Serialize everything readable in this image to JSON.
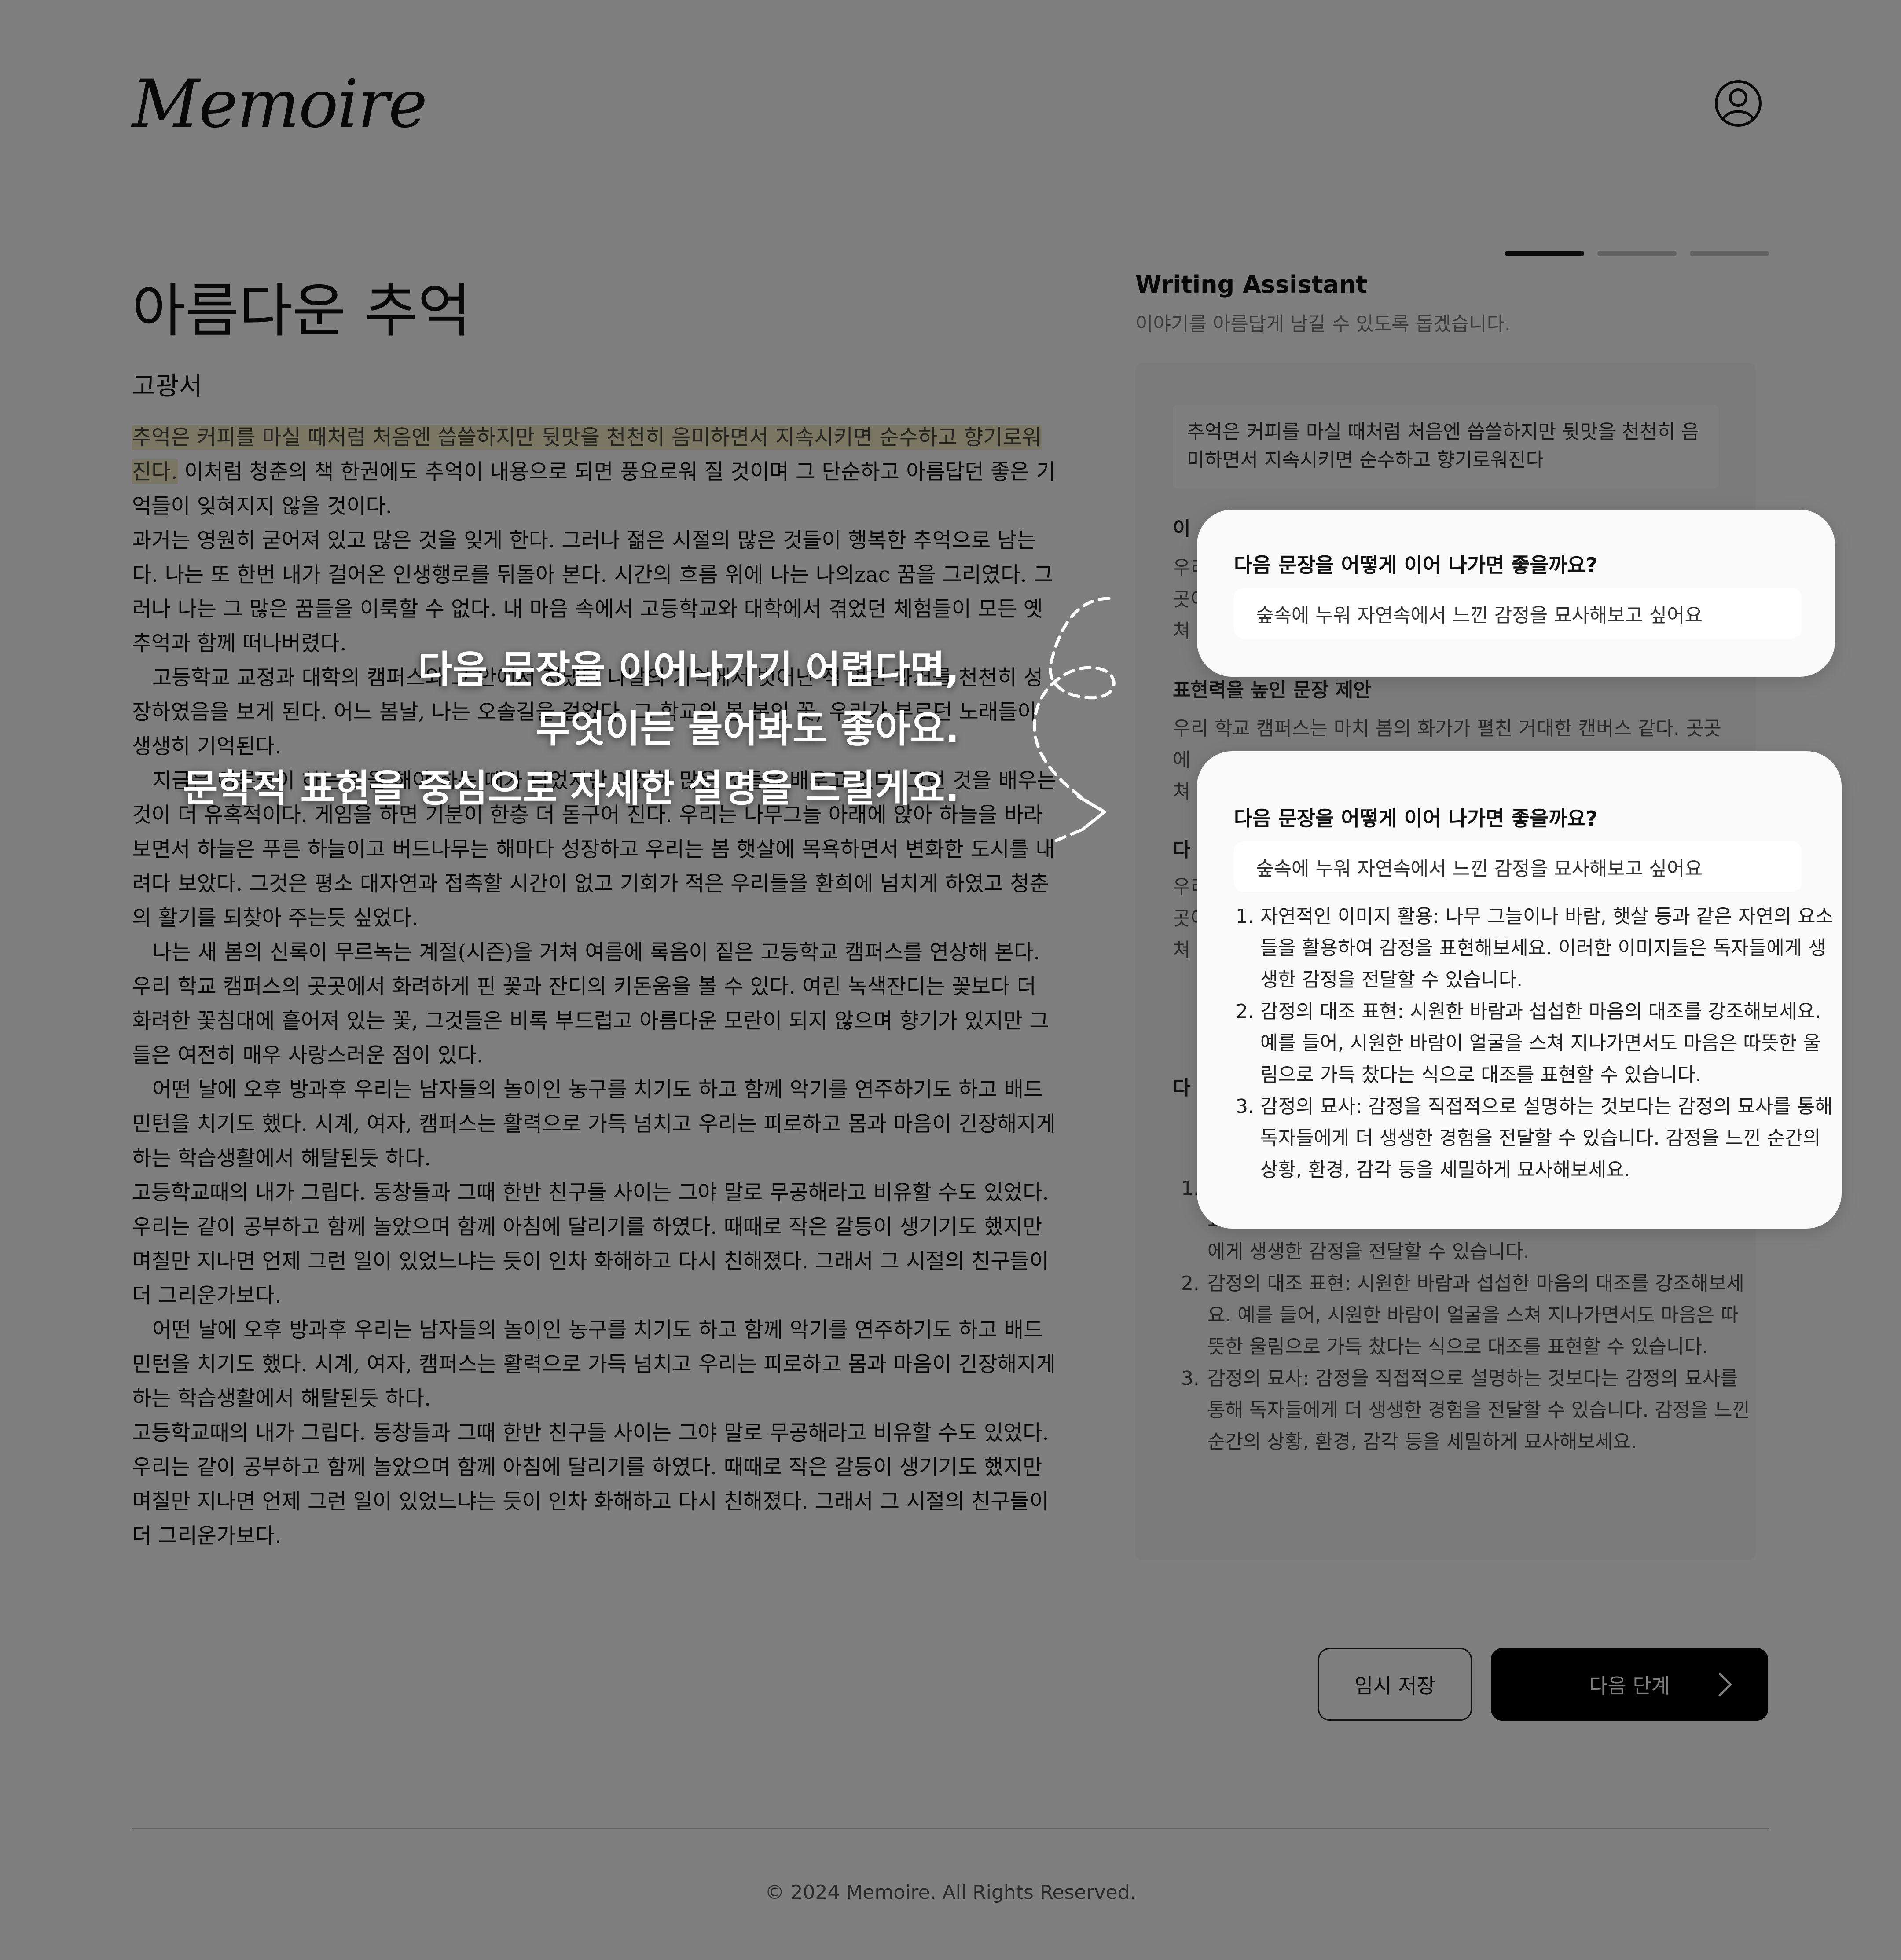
{
  "header": {
    "logo": "Memoire",
    "user_icon": "user-circle-icon"
  },
  "document": {
    "title": "아름다운 추억",
    "author": "고광서",
    "highlight": "추억은 커피를 마실 때처럼 처음엔 씁쓸하지만 뒷맛을 천천히 음미하면서 지속시키면 순수하고 향기로워진다.",
    "p1_rest": " 이처럼 청춘의 책 한권에도 추억이 내용으로 되면 풍요로워 질 것이며 그 단순하고 아름답던 좋은 기억들이 잊혀지지 않을 것이다.",
    "paragraphs": [
      "과거는 영원히 굳어져 있고 많은 것을 잊게 한다. 그러나 젊은 시절의 많은 것들이 행복한 추억으로 남는다. 나는 또 한번 내가 걸어온 인생행로를 뒤돌아 본다. 시간의 흐름 위에 나는 나의zac 꿈을 그리였다. 그러나 나는 그 많은 꿈들을 이룩할 수 없다. 내 마음 속에서 고등학교와 대학에서 겪었던 체험들이 모든 옛추억과 함께 떠나버렸다.",
      "고등학교 교정과 대학의 캠퍼스와 그 안에서 지냈던 나날의 기억에서 벗어난 적 없던 과거를 천천히 성장하였음을 보게 된다. 어느 봄날, 나는 오솔길을 걸었다. 그 학교의 봄 본인 꽃, 우리가 부르던 노래들이 생생히 기억된다.",
      "지금은 어른들이 하는 일을 해야 하는 때가 되었지만 여전히 많은 것들을 배우고 있다. 그런 것을 배우는 것이 더 유혹적이다. 게임을 하면 기분이 한층 더 돋구어 진다. 우리는 나무그늘 아래에 앉아 하늘을 바라보면서 하늘은 푸른 하늘이고 버드나무는 해마다 성장하고 우리는 봄 햇살에 목욕하면서 변화한 도시를 내려다 보았다. 그것은 평소 대자연과 접촉할 시간이 없고 기회가 적은 우리들을 환희에 넘치게 하였고 청춘의 활기를 되찾아 주는듯 싶었다.",
      "나는 새 봄의 신록이 무르녹는 계절(시즌)을 거쳐 여름에 록음이 짙은 고등학교 캠퍼스를 연상해 본다. 우리 학교 캠퍼스의 곳곳에서 화려하게 핀 꽃과 잔디의 키돈움을 볼 수 있다. 여린 녹색잔디는 꽃보다 더 화려한 꽃침대에 흩어져 있는 꽃, 그것들은 비록 부드럽고 아름다운 모란이 되지 않으며  향기가 있지만 그들은 여전히 매우 사랑스러운 점이 있다.",
      "어떤 날에 오후 방과후 우리는 남자들의 놀이인 농구를 치기도 하고 함께 악기를 연주하기도 하고 배드민턴을 치기도 했다. 시계, 여자, 캠퍼스는 활력으로 가득 넘치고 우리는 피로하고 몸과 마음이 긴장해지게 하는 학습생활에서 해탈된듯 하다.",
      "고등학교때의 내가 그립다. 동창들과 그때 한반 친구들 사이는 그야 말로 무공해라고 비유할 수도 있었다. 우리는  같이 공부하고 함께 놀았으며 함께 아침에 달리기를 하였다. 때때로 작은 갈등이 생기기도 했지만  며칠만 지나면 언제 그런 일이 있었느냐는 듯이 인차 화해하고 다시 친해졌다. 그래서 그 시절의 친구들이 더 그리운가보다.",
      "어떤 날에 오후 방과후 우리는 남자들의 놀이인 농구를 치기도 하고 함께 악기를 연주하기도 하고 배드민턴을 치기도 했다. 시계, 여자, 캠퍼스는 활력으로 가득 넘치고 우리는 피로하고 몸과 마음이 긴장해지게 하는 학습생활에서 해탈된듯 하다.",
      "고등학교때의 내가 그립다. 동창들과 그때 한반 친구들 사이는 그야 말로 무공해라고 비유할 수도 있었다. 우리는  같이 공부하고 함께 놀았으며 함께 아침에 달리기를 하였다. 때때로 작은 갈등이 생기기도 했지만  며칠만 지나면 언제 그런 일이 있었느냐는 듯이 인차 화해하고 다시 친해졌다. 그래서 그 시절의 친구들이 더 그리운가보다."
    ]
  },
  "assistant": {
    "steps": {
      "current": 1,
      "total": 3
    },
    "title": "Writing Assistant",
    "subtitle": "이야기를 아름답게 남길 수 있도록 돕겠습니다.",
    "quote": "추억은 커피를 마실 때처럼 처음엔 씁쓸하지만 뒷맛을 천천히 음미하면서 지속시키면 순수하고 향기로워진다",
    "section1_title": "이",
    "section1_text": "우리\n곳어\n쳐",
    "section2_title": "표현력을 높인 문장 제안",
    "section2_text": "우리 학교 캠퍼스는 마치 봄의 화가가 펼친 거대한 캔버스 같다. 곳곳에\n쳐",
    "section3_title": "다",
    "section3_text": "우리\n곳어\n쳐",
    "section4_title": "다",
    "list": [
      "자연적인 이미지 활용: 나무 그늘이나 바람, 햇살 등과 같은 자연의 요소들을 활용하여 감정을 표현해보세요. 이러한 이미지들은 독자들에게 생생한 감정을 전달할 수 있습니다.",
      "감정의 대조 표현: 시원한 바람과 섭섭한 마음의 대조를 강조해보세요. 예를 들어, 시원한 바람이 얼굴을 스쳐 지나가면서도 마음은 따뜻한 울림으로 가득 찼다는 식으로 대조를 표현할 수 있습니다.",
      "감정의 묘사: 감정을 직접적으로 설명하는 것보다는 감정의 묘사를 통해 독자들에게 더 생생한 경험을 전달할 수 있습니다. 감정을 느낀 순간의 상황, 환경, 감각 등을 세밀하게 묘사해보세요."
    ]
  },
  "buttons": {
    "save": "임시 저장",
    "next": "다음 단계"
  },
  "footer": {
    "copyright": "© 2024 Memoire. All Rights Reserved."
  },
  "overlay": {
    "tip_lines": [
      "다음 문장을 이어나가기 어렵다면,",
      "무엇이든 물어봐도 좋아요.",
      "문학적 표현을 중심으로 자세한 설명을 드릴게요."
    ],
    "card1": {
      "question": "다음 문장을 어떻게 이어 나가면 좋을까요?",
      "input": "숲속에 누워 자연속에서 느낀 감정을 묘사해보고 싶어요"
    },
    "card2": {
      "question": "다음 문장을 어떻게 이어 나가면 좋을까요?",
      "input": "숲속에 누워 자연속에서 느낀 감정을 묘사해보고 싶어요",
      "answers": [
        "자연적인 이미지 활용: 나무 그늘이나 바람, 햇살 등과 같은 자연의 요소들을 활용하여 감정을 표현해보세요. 이러한 이미지들은 독자들에게 생생한 감정을 전달할 수 있습니다.",
        "감정의 대조 표현: 시원한 바람과 섭섭한 마음의 대조를 강조해보세요. 예를 들어, 시원한 바람이 얼굴을 스쳐 지나가면서도 마음은 따뜻한 울림으로 가득 찼다는 식으로 대조를 표현할 수 있습니다.",
        "감정의 묘사: 감정을 직접적으로 설명하는 것보다는 감정의 묘사를 통해 독자들에게 더 생생한 경험을 전달할 수 있습니다. 감정을 느낀 순간의 상황, 환경, 감각 등을 세밀하게 묘사해보세요."
      ]
    }
  },
  "colors": {
    "highlight": "#f2ecc8",
    "accent": "#000000",
    "overlay": "rgba(0,0,0,0.5)"
  }
}
